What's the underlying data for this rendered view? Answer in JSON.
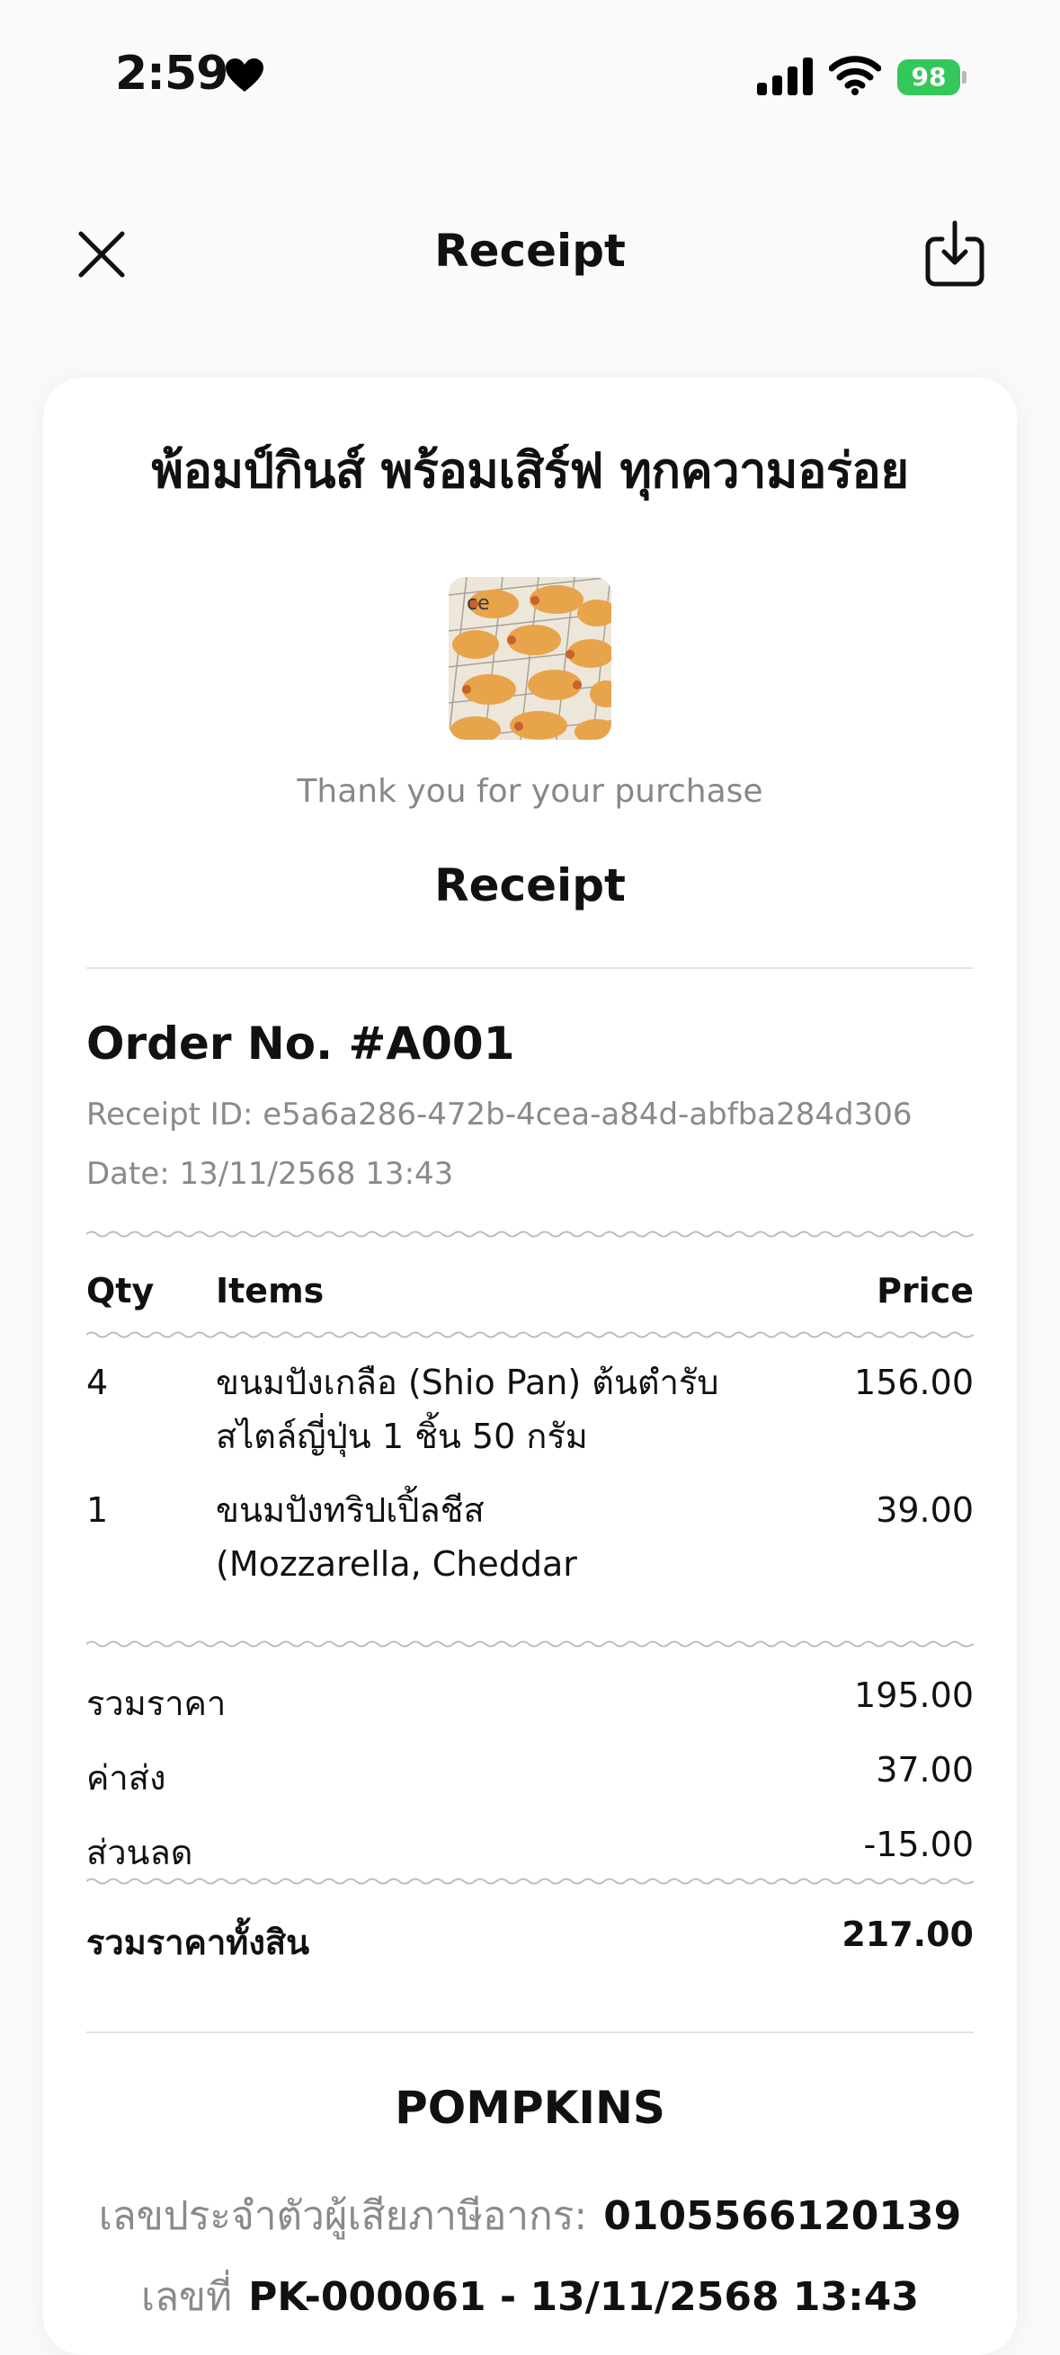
{
  "status_bar": {
    "time": "2:59",
    "battery": "98"
  },
  "nav": {
    "title": "Receipt"
  },
  "shop": {
    "headline": "พ้อมป์กินส์ พร้อมเสิร์ฟ ทุกความอร่อย",
    "image_text": "ce"
  },
  "thank_you": "Thank you for your purchase",
  "receipt_heading": "Receipt",
  "order": {
    "number": "Order No. #A001",
    "receipt_id": "Receipt ID: e5a6a286-472b-4cea-a84d-abfba284d306",
    "date": "Date: 13/11/2568 13:43"
  },
  "table": {
    "headers": {
      "qty": "Qty",
      "items": "Items",
      "price": "Price"
    },
    "rows": [
      {
        "qty": "4",
        "line1": "ขนมปังเกลือ (Shio Pan) ต้นตำรับ",
        "line2": "สไตล์ญี่ปุ่น 1 ชิ้น 50 กรัม",
        "price": "156.00"
      },
      {
        "qty": "1",
        "line1": "ขนมปังทริปเปิ้ลชีส",
        "line2": "(Mozzarella, Cheddar",
        "price": "39.00"
      }
    ]
  },
  "summary": {
    "subtotal_label": "รวมราคา",
    "subtotal": "195.00",
    "shipping_label": "ค่าส่ง",
    "shipping": "37.00",
    "discount_label": "ส่วนลด",
    "discount": "-15.00",
    "total_label": "รวมราคาทั้งสิน",
    "total": "217.00"
  },
  "company": {
    "name": "POMPKINS",
    "tax_label": "เลขประจำตัวผู้เสียภาษีอากร:",
    "tax_id": "0105566120139",
    "doc_label": "เลขที่",
    "doc_value": "PK-000061 - 13/11/2568 13:43"
  },
  "colors": {
    "battery": "#34c759",
    "muted_text": "#8a8a8a",
    "background": "#fafafa"
  },
  "icons": {
    "close": "close-icon",
    "download": "download-icon",
    "heart": "heart-icon",
    "signal": "signal-icon",
    "wifi": "wifi-icon"
  }
}
